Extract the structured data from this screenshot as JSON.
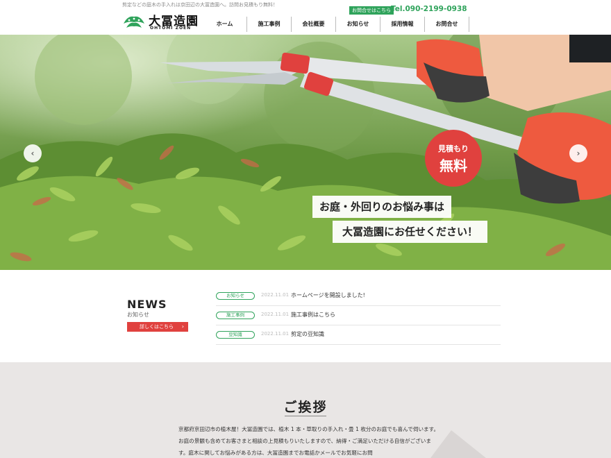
{
  "header": {
    "tagline": "剪定などの庭木の手入れは京田辺の大冨造園へ。訪問お見積もり無料！",
    "logo_title": "大冨造園",
    "logo_sub": "OHTOMI ZOEN",
    "contact_badge": "お問合せはこちら",
    "tel": "Tel.090-2199-0938",
    "nav": [
      "ホーム",
      "施工事例",
      "会社概要",
      "お知らせ",
      "採用情報",
      "お問合せ"
    ]
  },
  "hero": {
    "prev_icon": "‹",
    "next_icon": "›",
    "badge_line1": "見積もり",
    "badge_line2": "無料",
    "catch_line1": "お庭・外回りのお悩み事は",
    "catch_line2": "大冨造園にお任せください！"
  },
  "news": {
    "title": "NEWS",
    "subtitle": "お知らせ",
    "more_label": "詳しくはこちら",
    "more_icon": "›",
    "items": [
      {
        "tag": "お知らせ",
        "date": "2022.11.01",
        "text": "ホームページを開設しました!"
      },
      {
        "tag": "施工事例",
        "date": "2022.11.01",
        "text": "施工事例はこちら"
      },
      {
        "tag": "豆知識",
        "date": "2022.11.01",
        "text": "剪定の豆知識"
      }
    ]
  },
  "greeting": {
    "title": "ご挨拶",
    "body": "京都府京田辺市の植木屋！大冨造園では、植木 1 本・草取りの手入れ・畳 1 枚分のお庭でも喜んで伺います。お庭の景観も含めてお客さまと相談の上見積もりいたしますので、納得・ご満足いただける自信がございます。庭木に関してお悩みがある方は、大冨造園までお電話かメールでお気軽にお問"
  },
  "colors": {
    "accent_green": "#2fa35b",
    "accent_red": "#e0413e",
    "greeting_bg": "#e9e6e5"
  }
}
